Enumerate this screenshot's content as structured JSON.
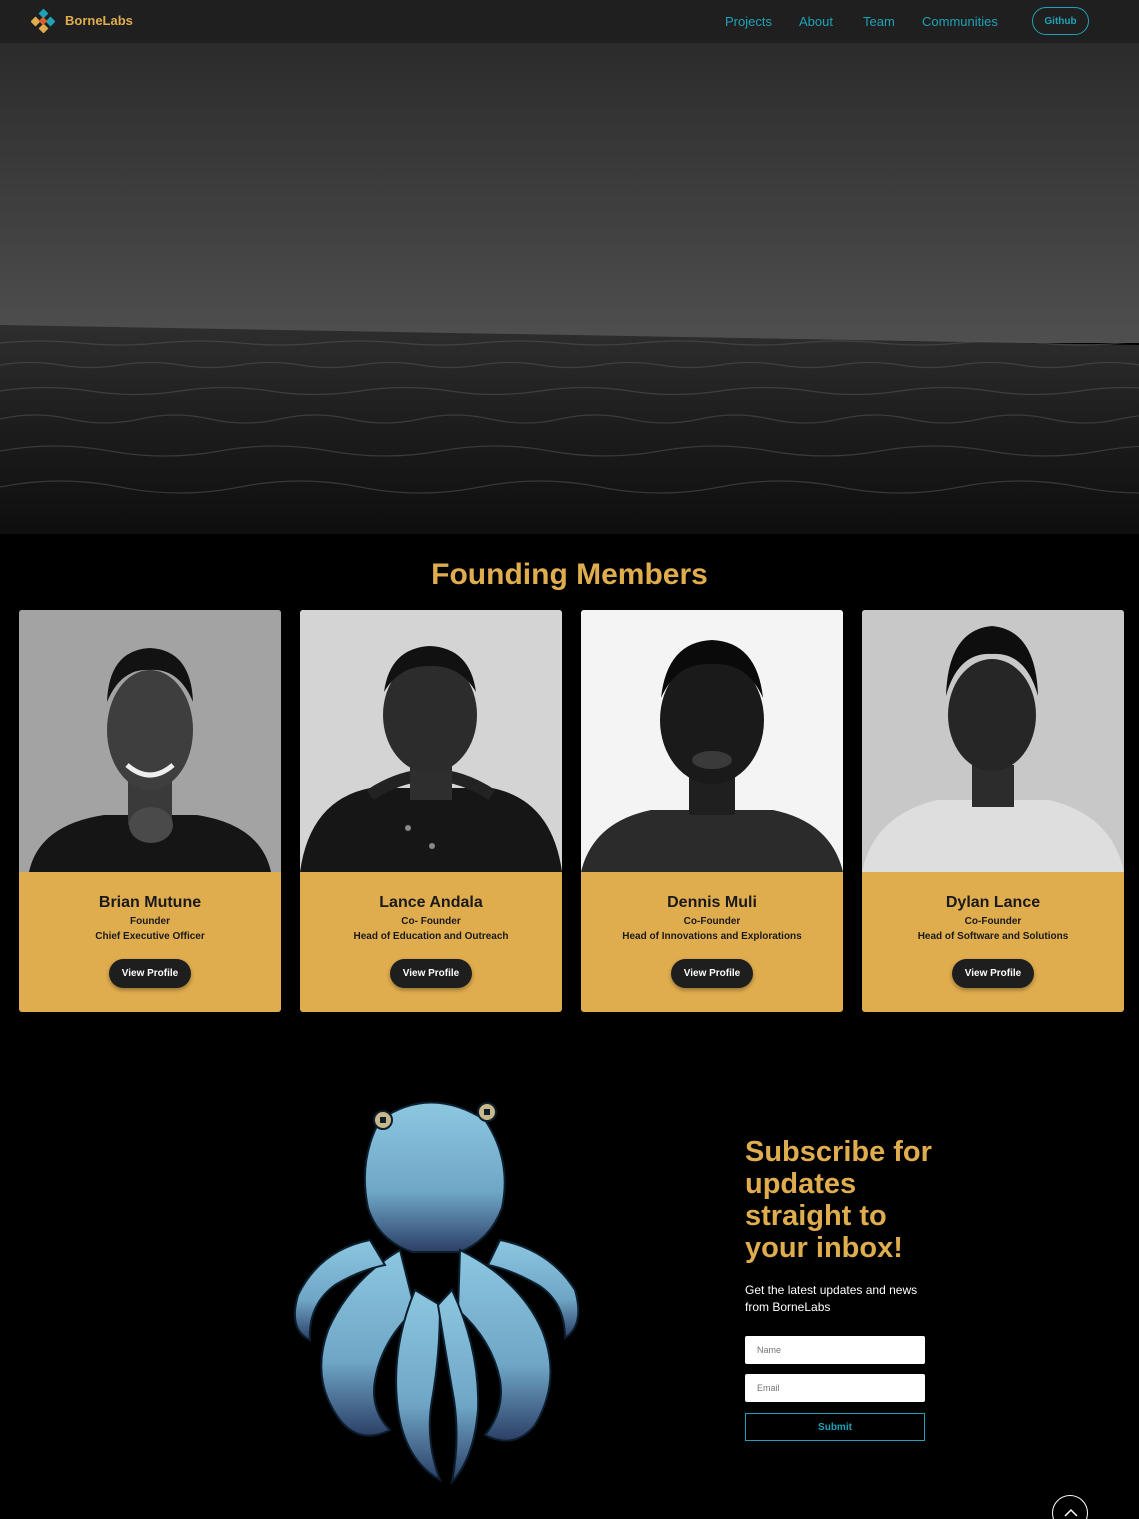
{
  "nav": {
    "brand": "BorneLabs",
    "links": [
      "Projects",
      "About",
      "Team",
      "Communities"
    ],
    "github_label": "Github"
  },
  "colors": {
    "accent": "#e0ad4e",
    "link": "#1fa2b8",
    "nav_bg": "#1f1f1f",
    "page_bg": "#000000"
  },
  "founders": {
    "title": "Founding Members",
    "members": [
      {
        "name": "Brian Mutune",
        "role": "Founder",
        "title": "Chief Executive Officer",
        "button": "View Profile"
      },
      {
        "name": "Lance Andala",
        "role": "Co- Founder",
        "title": "Head of Education and Outreach",
        "button": "View Profile"
      },
      {
        "name": "Dennis Muli",
        "role": "Co-Founder",
        "title": "Head of Innovations and Explorations",
        "button": "View Profile"
      },
      {
        "name": "Dylan Lance",
        "role": "Co-Founder",
        "title": "Head of Software and Solutions",
        "button": "View Profile"
      }
    ]
  },
  "subscribe": {
    "heading": "Subscribe for updates straight to your inbox!",
    "text": "Get the latest updates and news from BorneLabs",
    "name_placeholder": "Name",
    "email_placeholder": "Email",
    "submit_label": "Submit"
  },
  "icons": {
    "logo": "borne-labs-logo",
    "scroll_top": "chevron-up-icon"
  }
}
